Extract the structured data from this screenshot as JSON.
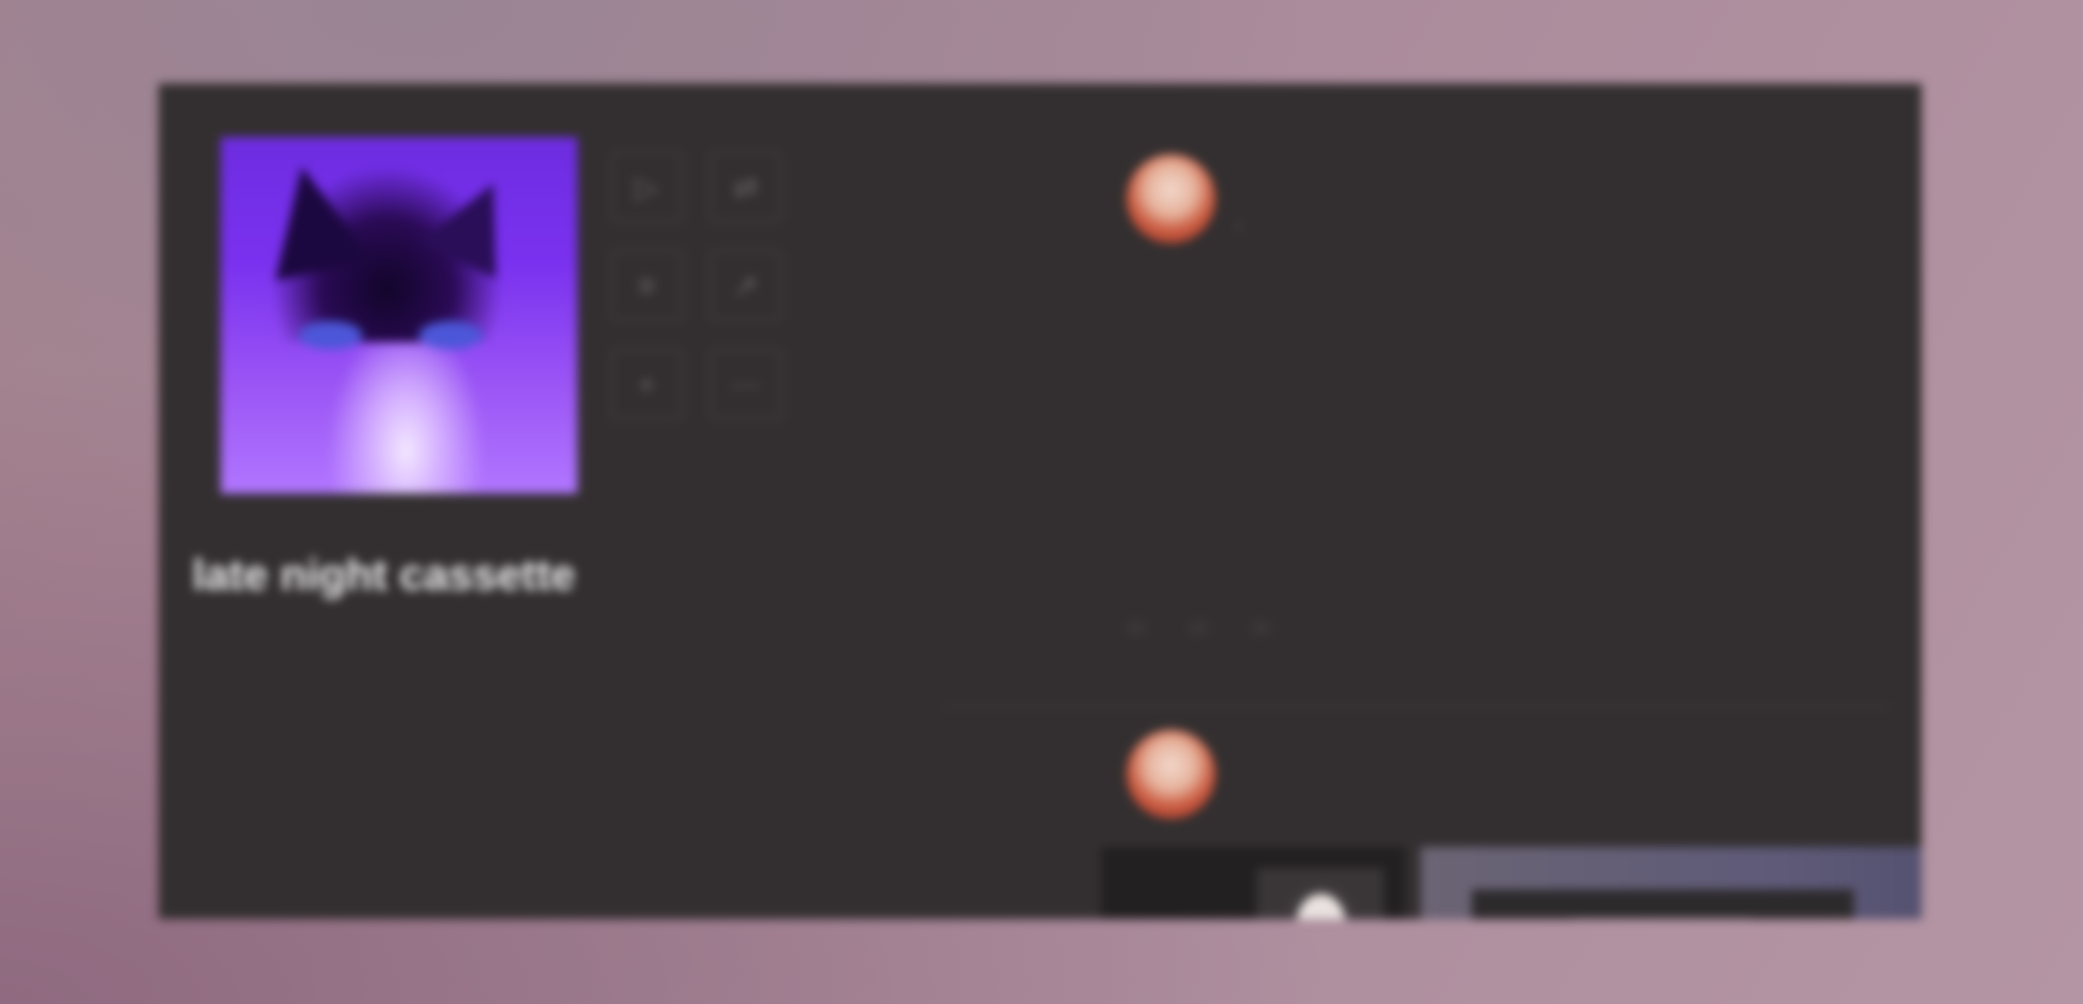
{
  "playlist": {
    "title": "late night cassette",
    "description": "",
    "description_secondary": ""
  },
  "sidebar_icons": [
    {
      "name": "play-icon",
      "glyph": "▷"
    },
    {
      "name": "shuffle-icon",
      "glyph": "⇄"
    },
    {
      "name": "list-icon",
      "glyph": "≡"
    },
    {
      "name": "share-icon",
      "glyph": "↗"
    },
    {
      "name": "add-icon",
      "glyph": "+"
    },
    {
      "name": "more-icon",
      "glyph": "⋯"
    }
  ],
  "feed": {
    "posts": [
      {
        "author": "",
        "time": "",
        "channel": "",
        "body": "",
        "likes": "",
        "right": "",
        "reactions": [
          "",
          "",
          ""
        ]
      },
      {
        "author": "",
        "time": ""
      }
    ]
  },
  "colors": {
    "panel": "#332f30",
    "accent_purple": "#7a31ef",
    "text": "#f0eeef"
  }
}
